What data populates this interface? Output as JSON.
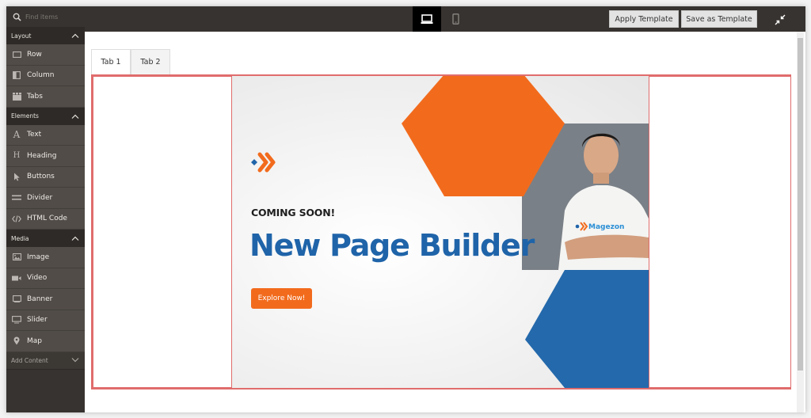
{
  "toolbar": {
    "search_placeholder": "Find items",
    "device_desktop": "desktop-view",
    "device_mobile": "mobile-view",
    "apply_template": "Apply Template",
    "save_as_template": "Save as Template"
  },
  "sidebar": {
    "sections": [
      {
        "title": "Layout",
        "items": [
          {
            "label": "Row",
            "icon": "row-icon"
          },
          {
            "label": "Column",
            "icon": "column-icon"
          },
          {
            "label": "Tabs",
            "icon": "tabs-icon"
          }
        ]
      },
      {
        "title": "Elements",
        "items": [
          {
            "label": "Text",
            "icon": "text-icon"
          },
          {
            "label": "Heading",
            "icon": "heading-icon"
          },
          {
            "label": "Buttons",
            "icon": "pointer-icon"
          },
          {
            "label": "Divider",
            "icon": "divider-icon"
          },
          {
            "label": "HTML Code",
            "icon": "code-icon"
          }
        ]
      },
      {
        "title": "Media",
        "items": [
          {
            "label": "Image",
            "icon": "image-icon"
          },
          {
            "label": "Video",
            "icon": "video-icon"
          },
          {
            "label": "Banner",
            "icon": "banner-icon"
          },
          {
            "label": "Slider",
            "icon": "slider-icon"
          },
          {
            "label": "Map",
            "icon": "map-pin-icon"
          }
        ]
      }
    ],
    "add_content": "Add Content"
  },
  "stage": {
    "tabs": [
      {
        "label": "Tab 1",
        "active": true
      },
      {
        "label": "Tab 2",
        "active": false
      }
    ],
    "banner": {
      "eyebrow": "COMING SOON!",
      "headline": "New Page Builder",
      "cta": "Explore Now!",
      "shirt_brand": "Magezon"
    }
  },
  "colors": {
    "accent_orange": "#f26b1d",
    "accent_blue": "#1f64a9",
    "toolbar_bg": "#373330",
    "selection_outline": "#e06c6c"
  }
}
